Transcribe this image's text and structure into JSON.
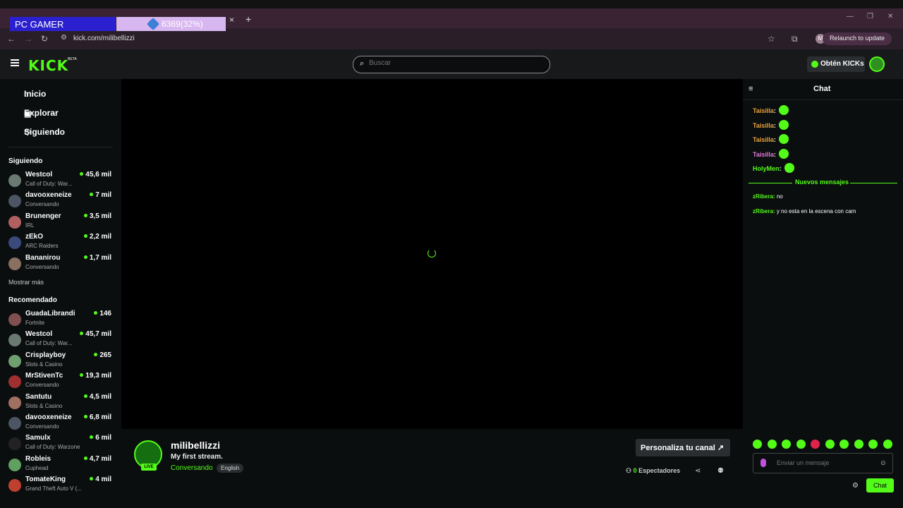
{
  "browser": {
    "overlay_label": "PC GAMER",
    "tab_label": "6369(32%)",
    "tab_close": "×",
    "new_tab": "+",
    "url": "kick.com/milibellizzi",
    "relaunch": "Relaunch to update",
    "profile_initial": "M"
  },
  "header": {
    "logo": "KICK",
    "beta": "BETA",
    "search_placeholder": "Buscar",
    "get_kicks": "Obtén KICKs"
  },
  "sidebar": {
    "nav": [
      "Inicio",
      "Explorar",
      "Siguiendo"
    ],
    "following_title": "Siguiendo",
    "following": [
      {
        "name": "Westcol",
        "category": "Call of Duty: War...",
        "viewers": "45,6 mil"
      },
      {
        "name": "davooxeneize",
        "category": "Conversando",
        "viewers": "7 mil"
      },
      {
        "name": "Brunenger",
        "category": "IRL",
        "viewers": "3,5 mil"
      },
      {
        "name": "zEkO",
        "category": "ARC Raiders",
        "viewers": "2,2 mil"
      },
      {
        "name": "Bananirou",
        "category": "Conversando",
        "viewers": "1,7 mil"
      }
    ],
    "show_more": "Mostrar más",
    "recommended_title": "Recomendado",
    "recommended": [
      {
        "name": "GuadaLibrandi",
        "category": "Fortnite",
        "viewers": "146"
      },
      {
        "name": "Westcol",
        "category": "Call of Duty: War...",
        "viewers": "45,7 mil"
      },
      {
        "name": "Crisplayboy",
        "category": "Slots & Casino",
        "viewers": "265"
      },
      {
        "name": "MrStivenTc",
        "category": "Conversando",
        "viewers": "19,3 mil"
      },
      {
        "name": "Santutu",
        "category": "Slots & Casino",
        "viewers": "4,5 mil"
      },
      {
        "name": "davooxeneize",
        "category": "Conversando",
        "viewers": "6,8 mil"
      },
      {
        "name": "Samulx",
        "category": "Call of Duty: Warzone",
        "viewers": "6 mil"
      },
      {
        "name": "Robleis",
        "category": "Cuphead",
        "viewers": "4,7 mil"
      },
      {
        "name": "TomateKing",
        "category": "Grand Theft Auto V (...",
        "viewers": "4 mil"
      }
    ]
  },
  "stream": {
    "channel": "milibellizzi",
    "title": "My first stream.",
    "category": "Conversando",
    "language": "English",
    "live_badge": "LIVE",
    "customize": "Personaliza tu canal",
    "viewer_count": "0",
    "viewer_label": "Espectadores"
  },
  "chat": {
    "title": "Chat",
    "messages_old": [
      {
        "user": "Taisilla",
        "color": "#e9a23b"
      },
      {
        "user": "Taisilla",
        "color": "#e9a23b"
      },
      {
        "user": "Taisilla",
        "color": "#e9a23b"
      },
      {
        "user": "Taisilla",
        "color": "#e07ad8"
      },
      {
        "user": "HolyMen",
        "color": "#53fc18"
      }
    ],
    "new_messages_label": "Nuevos mensajes",
    "messages_new": [
      {
        "user": "zRibera",
        "text": "no"
      },
      {
        "user": "zRibera",
        "text": "y no esta en la escena con cam"
      }
    ],
    "input_placeholder": "Enviar un mensaje",
    "send_label": "Chat"
  }
}
